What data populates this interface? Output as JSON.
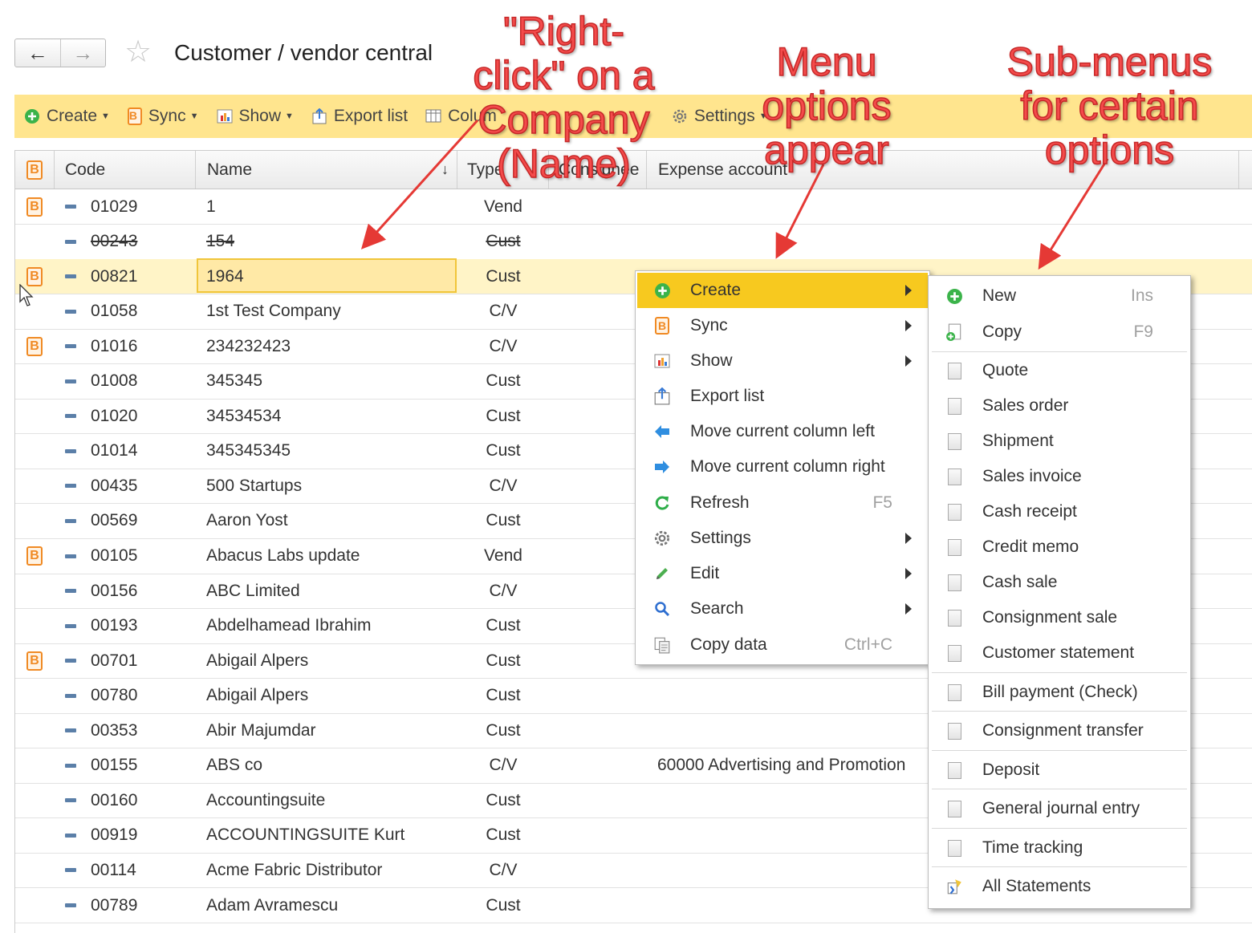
{
  "nav": {
    "back_icon": "arrow-left-icon",
    "forward_icon": "arrow-right-icon",
    "title": "Customer / vendor central"
  },
  "toolbar": {
    "create": "Create",
    "sync": "Sync",
    "show": "Show",
    "export": "Export list",
    "columns": "Colum",
    "settings": "Settings"
  },
  "grid": {
    "headers": {
      "code": "Code",
      "name": "Name",
      "sort": "↓",
      "type": "Type",
      "consignee": "Consignee",
      "expense": "Expense account"
    },
    "rows": [
      {
        "b": true,
        "code": "01029",
        "name": "1",
        "type": "Vend",
        "expense": ""
      },
      {
        "b": false,
        "code": "00243",
        "name": "154",
        "type": "Cust",
        "expense": "",
        "strike": true
      },
      {
        "b": true,
        "code": "00821",
        "name": "1964",
        "type": "Cust",
        "expense": "",
        "selected": true
      },
      {
        "b": false,
        "code": "01058",
        "name": "1st Test Company",
        "type": "C/V",
        "expense": ""
      },
      {
        "b": true,
        "code": "01016",
        "name": "234232423",
        "type": "C/V",
        "expense": ""
      },
      {
        "b": false,
        "code": "01008",
        "name": "345345",
        "type": "Cust",
        "expense": ""
      },
      {
        "b": false,
        "code": "01020",
        "name": "34534534",
        "type": "Cust",
        "expense": ""
      },
      {
        "b": false,
        "code": "01014",
        "name": "345345345",
        "type": "Cust",
        "expense": ""
      },
      {
        "b": false,
        "code": "00435",
        "name": "500 Startups",
        "type": "C/V",
        "expense": ""
      },
      {
        "b": false,
        "code": "00569",
        "name": "Aaron Yost",
        "type": "Cust",
        "expense": ""
      },
      {
        "b": true,
        "code": "00105",
        "name": "Abacus Labs update",
        "type": "Vend",
        "expense": ""
      },
      {
        "b": false,
        "code": "00156",
        "name": "ABC Limited",
        "type": "C/V",
        "expense": ""
      },
      {
        "b": false,
        "code": "00193",
        "name": "Abdelhamead Ibrahim",
        "type": "Cust",
        "expense": ""
      },
      {
        "b": true,
        "code": "00701",
        "name": "Abigail Alpers",
        "type": "Cust",
        "expense": ""
      },
      {
        "b": false,
        "code": "00780",
        "name": "Abigail Alpers",
        "type": "Cust",
        "expense": ""
      },
      {
        "b": false,
        "code": "00353",
        "name": "Abir Majumdar",
        "type": "Cust",
        "expense": ""
      },
      {
        "b": false,
        "code": "00155",
        "name": "ABS co",
        "type": "C/V",
        "expense": "60000 Advertising and Promotion"
      },
      {
        "b": false,
        "code": "00160",
        "name": "Accountingsuite",
        "type": "Cust",
        "expense": ""
      },
      {
        "b": false,
        "code": "00919",
        "name": "ACCOUNTINGSUITE Kurt",
        "type": "Cust",
        "expense": ""
      },
      {
        "b": false,
        "code": "00114",
        "name": "Acme Fabric Distributor",
        "type": "C/V",
        "expense": ""
      },
      {
        "b": false,
        "code": "00789",
        "name": "Adam Avramescu",
        "type": "Cust",
        "expense": ""
      }
    ]
  },
  "context_menu": {
    "items": [
      {
        "label": "Create",
        "icon": "plus-circle-icon",
        "submenu": true,
        "active": true
      },
      {
        "label": "Sync",
        "icon": "sync-b-icon",
        "submenu": true
      },
      {
        "label": "Show",
        "icon": "chart-icon",
        "submenu": true
      },
      {
        "label": "Export list",
        "icon": "export-icon"
      },
      {
        "label": "Move current column left",
        "icon": "arrow-left-icon"
      },
      {
        "label": "Move current column right",
        "icon": "arrow-right-icon"
      },
      {
        "label": "Refresh",
        "icon": "refresh-icon",
        "shortcut": "F5"
      },
      {
        "label": "Settings",
        "icon": "gear-icon",
        "submenu": true
      },
      {
        "label": "Edit",
        "icon": "pencil-icon",
        "submenu": true
      },
      {
        "label": "Search",
        "icon": "search-icon",
        "submenu": true
      },
      {
        "label": "Copy data",
        "icon": "copy-data-icon",
        "shortcut": "Ctrl+C"
      }
    ]
  },
  "sub_menu": {
    "items": [
      {
        "label": "New",
        "icon": "plus-circle-icon",
        "shortcut": "Ins"
      },
      {
        "label": "Copy",
        "icon": "copy-doc-icon",
        "shortcut": "F9"
      },
      {
        "label": "Quote",
        "icon": "document-icon"
      },
      {
        "label": "Sales order",
        "icon": "document-icon"
      },
      {
        "label": "Shipment",
        "icon": "document-icon"
      },
      {
        "label": "Sales invoice",
        "icon": "document-icon"
      },
      {
        "label": "Cash receipt",
        "icon": "document-icon"
      },
      {
        "label": "Credit memo",
        "icon": "document-icon"
      },
      {
        "label": "Cash sale",
        "icon": "document-icon"
      },
      {
        "label": "Consignment sale",
        "icon": "document-icon"
      },
      {
        "label": "Customer statement",
        "icon": "document-icon"
      },
      {
        "label": "Bill payment (Check)",
        "icon": "document-icon"
      },
      {
        "label": "Consignment transfer",
        "icon": "document-icon"
      },
      {
        "label": "Deposit",
        "icon": "document-icon"
      },
      {
        "label": "General journal entry",
        "icon": "document-icon"
      },
      {
        "label": "Time tracking",
        "icon": "document-icon"
      },
      {
        "label": "All Statements",
        "icon": "statements-icon"
      }
    ]
  },
  "annotations": {
    "right_click": [
      "\"Right-",
      "click\" on a",
      "Company",
      "(Name)"
    ],
    "menu_options": [
      "Menu",
      "options",
      "appear"
    ],
    "sub_menus": [
      "Sub-menus",
      "for certain",
      "options"
    ]
  },
  "colors": {
    "toolbar_bg": "#ffe58e",
    "menu_active": "#f7c91f",
    "annotation": "#f44b4b",
    "selected_row": "#fff4c7"
  }
}
